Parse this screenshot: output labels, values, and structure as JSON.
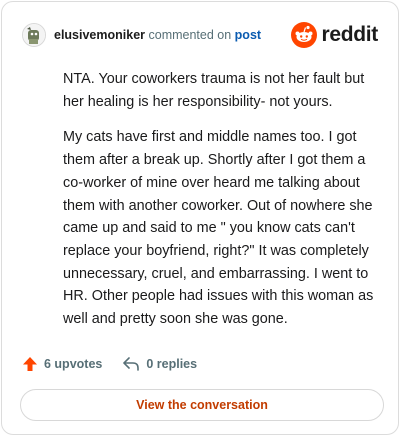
{
  "header": {
    "username": "elusivemoniker",
    "action_text": "commented on",
    "post_link": "post",
    "brand": "reddit"
  },
  "comment": {
    "paragraphs": [
      "NTA. Your coworkers trauma is not her fault but her healing is her responsibility- not yours.",
      "My cats have first and middle names too. I got them after a break up. Shortly after I got them a co-worker of mine over heard me talking about them with another coworker. Out of nowhere she came up and said to me \" you know cats can't replace your boyfriend, right?\" It was completely unnecessary, cruel, and embarrassing. I went to HR. Other people had issues with this woman as well and pretty soon she was gone."
    ]
  },
  "actions": {
    "upvotes": "6 upvotes",
    "replies": "0 replies"
  },
  "cta": {
    "label": "View the conversation"
  },
  "colors": {
    "brand": "#ff4500",
    "link": "#0a5bb0",
    "cta": "#c23c00",
    "meta": "#576f76"
  }
}
